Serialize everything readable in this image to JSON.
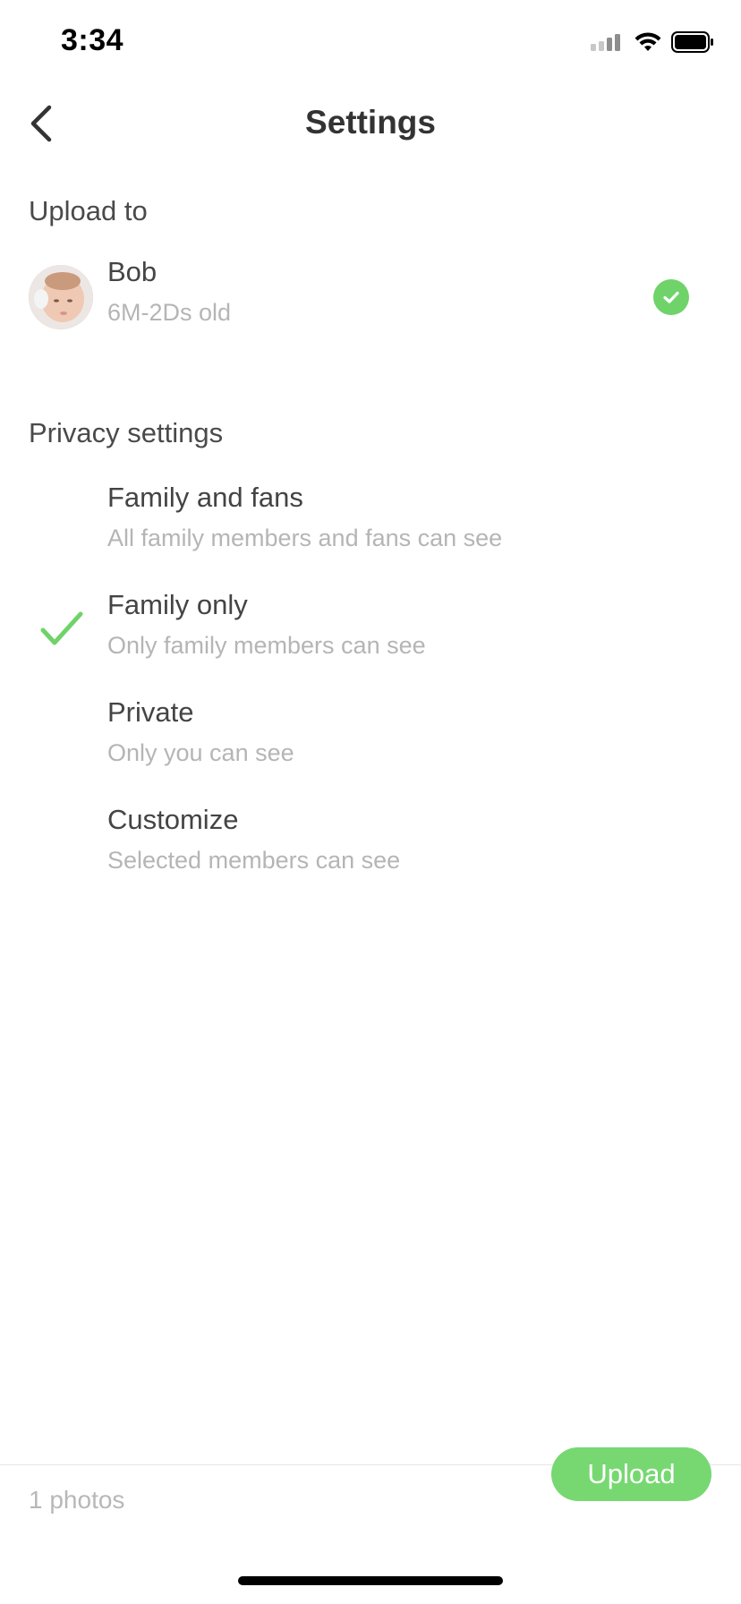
{
  "status_bar": {
    "time": "3:34",
    "icons": [
      "signal-icon",
      "wifi-icon",
      "battery-icon"
    ]
  },
  "nav": {
    "back_icon": "chevron-left-icon",
    "title": "Settings"
  },
  "upload_to": {
    "label": "Upload to",
    "child": {
      "name": "Bob",
      "age": "6M-2Ds old",
      "selected": true
    }
  },
  "privacy": {
    "label": "Privacy settings",
    "options": [
      {
        "title": "Family and fans",
        "subtitle": "All family members and fans can see",
        "selected": false
      },
      {
        "title": "Family only",
        "subtitle": "Only family members can see",
        "selected": true
      },
      {
        "title": "Private",
        "subtitle": "Only you can see",
        "selected": false
      },
      {
        "title": "Customize",
        "subtitle": "Selected members can see",
        "selected": false
      }
    ]
  },
  "footer": {
    "photo_count": "1 photos",
    "upload_label": "Upload"
  },
  "colors": {
    "accent_green": "#77d872",
    "check_green": "#6fd36a",
    "text_primary": "#444444",
    "text_secondary": "#b5b5b5"
  }
}
